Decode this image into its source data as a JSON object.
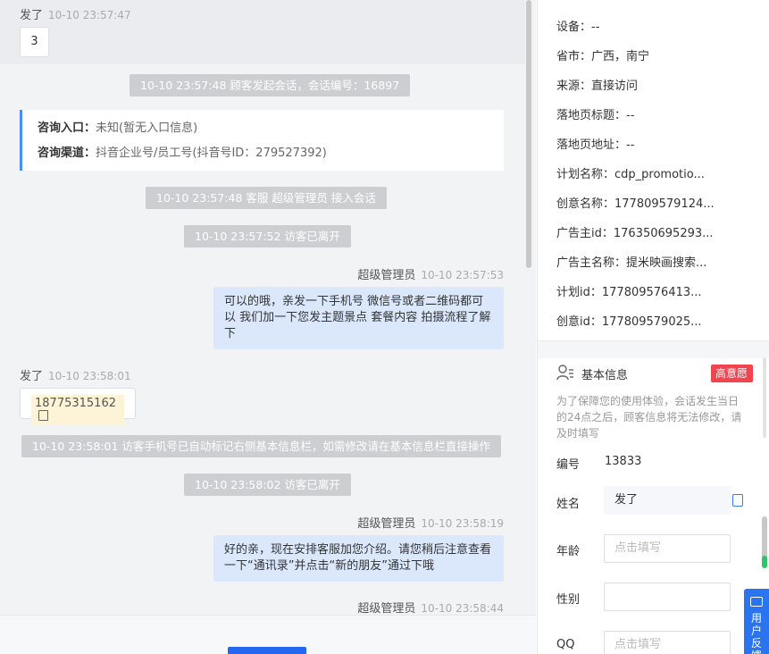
{
  "chat": {
    "top_sender": {
      "name": "发了",
      "time": "10-10 23:57:47"
    },
    "top_bubble": "3",
    "sys1": "10-10 23:57:48 顾客发起会话，会话编号：16897",
    "info": {
      "entry_label": "咨询入口：",
      "entry_value": "未知(暂无入口信息)",
      "channel_label": "咨询渠道：",
      "channel_value": "抖音企业号/员工号(抖音号ID：279527392)"
    },
    "sys2": "10-10 23:57:48 客服 超级管理员 接入会话",
    "sys3": "10-10 23:57:52 访客已离开",
    "agent1": {
      "name": "超级管理员",
      "time": "10-10 23:57:53"
    },
    "agent1_msg": "可以的哦，亲发一下手机号 微信号或者二维码都可以 我们加一下您发主题景点 套餐内容 拍摄流程了解下",
    "cust2": {
      "name": "发了",
      "time": "10-10 23:58:01"
    },
    "phone": "18775315162",
    "sys4": "10-10 23:58:01 访客手机号已自动标记右侧基本信息栏，如需修改请在基本信息栏直接操作",
    "sys5": "10-10 23:58:02 访客已离开",
    "agent2": {
      "name": "超级管理员",
      "time": "10-10 23:58:19"
    },
    "agent2_msg": "好的亲，现在安排客服加您介绍。请您稍后注意查看一下“通讯录”并点击“新的朋友”通过下哦",
    "agent3": {
      "name": "超级管理员",
      "time": "10-10 23:58:44"
    }
  },
  "panel": {
    "props": [
      {
        "k": "设备：",
        "v": "--"
      },
      {
        "k": "省市：",
        "v": "广西，南宁"
      },
      {
        "k": "来源：",
        "v": "直接访问"
      },
      {
        "k": "落地页标题：",
        "v": "--"
      },
      {
        "k": "落地页地址：",
        "v": "--"
      },
      {
        "k": "计划名称：",
        "v": "cdp_promotio..."
      },
      {
        "k": "创意名称：",
        "v": "177809579124..."
      },
      {
        "k": "广告主id：",
        "v": "176350695293..."
      },
      {
        "k": "广告主名称：",
        "v": "提米映画搜索..."
      },
      {
        "k": "计划id：",
        "v": "177809576413..."
      },
      {
        "k": "创意id：",
        "v": "177809579025..."
      }
    ],
    "basic": {
      "title": "基本信息",
      "tag": "高意愿 ▾",
      "note": "为了保障您的使用体验，会话发生当日的24点之后，顾客信息将无法修改，请及时填写",
      "id_label": "编号",
      "id_value": "13833",
      "name_label": "姓名",
      "name_value": "发了",
      "age_label": "年龄",
      "age_placeholder": "点击填写",
      "gender_label": "性别",
      "qq_label": "QQ",
      "qq_placeholder": "点击填写"
    },
    "feedback": "用户反馈"
  },
  "colors": {
    "accent": "#2468f2",
    "tag": "#f0454f",
    "bubble_out": "#dbe8fc"
  },
  "icons": [
    "copy-icon",
    "user-list-icon",
    "edit-icon",
    "chat-icon"
  ]
}
